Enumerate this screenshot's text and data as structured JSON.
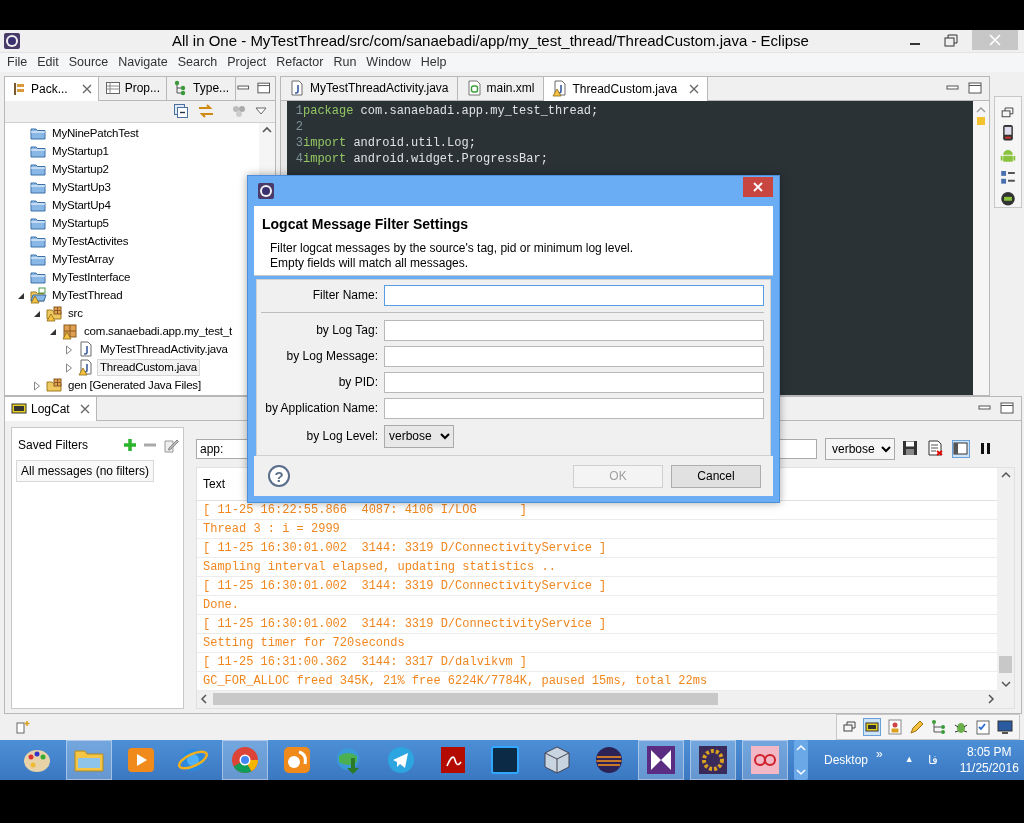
{
  "window": {
    "title": "All in One - MyTestThread/src/com/sanaebadi/app/my_test_thread/ThreadCustom.java - Eclipse"
  },
  "menu": [
    "File",
    "Edit",
    "Source",
    "Navigate",
    "Search",
    "Project",
    "Refactor",
    "Run",
    "Window",
    "Help"
  ],
  "explorer": {
    "tabs": [
      {
        "label": "Pack...",
        "selected": true
      },
      {
        "label": "Prop...",
        "selected": false
      },
      {
        "label": "Type...",
        "selected": false
      }
    ],
    "tree": [
      {
        "label": "MyNinePatchTest",
        "kind": "closed-project",
        "warning": false,
        "selected": false
      },
      {
        "label": "MyStartup1",
        "kind": "closed-project",
        "warning": false,
        "selected": false
      },
      {
        "label": "MyStartup2",
        "kind": "closed-project",
        "warning": false,
        "selected": false
      },
      {
        "label": "MyStartUp3",
        "kind": "closed-project",
        "warning": false,
        "selected": false
      },
      {
        "label": "MyStartUp4",
        "kind": "closed-project",
        "warning": false,
        "selected": false
      },
      {
        "label": "MyStartup5",
        "kind": "closed-project",
        "warning": false,
        "selected": false
      },
      {
        "label": "MyTestActivites",
        "kind": "closed-project",
        "warning": false,
        "selected": false
      },
      {
        "label": "MyTestArray",
        "kind": "closed-project",
        "warning": false,
        "selected": false
      },
      {
        "label": "MyTestInterface",
        "kind": "closed-project",
        "warning": false,
        "selected": false
      },
      {
        "label": "MyTestThread",
        "kind": "project",
        "warning": true,
        "selected": false,
        "expanded": true,
        "children": [
          {
            "label": "src",
            "kind": "source-folder",
            "warning": true,
            "selected": false,
            "expanded": true,
            "children": [
              {
                "label": "com.sanaebadi.app.my_test_t",
                "kind": "package",
                "warning": true,
                "selected": false,
                "expanded": true,
                "children": [
                  {
                    "label": "MyTestThreadActivity.java",
                    "kind": "java-file",
                    "warning": false,
                    "selected": false,
                    "expanded": false
                  },
                  {
                    "label": "ThreadCustom.java",
                    "kind": "java-file",
                    "warning": true,
                    "selected": true,
                    "expanded": false
                  }
                ]
              }
            ]
          },
          {
            "label": "gen [Generated Java Files]",
            "kind": "source-folder",
            "warning": false,
            "selected": false,
            "expanded": false
          }
        ]
      }
    ]
  },
  "editor": {
    "tabs": [
      {
        "label": "MyTestThreadActivity.java",
        "kind": "java",
        "warning": false,
        "selected": false
      },
      {
        "label": "main.xml",
        "kind": "xml",
        "warning": false,
        "selected": false
      },
      {
        "label": "ThreadCustom.java",
        "kind": "java",
        "warning": true,
        "selected": true
      }
    ],
    "lines": [
      {
        "number": "1",
        "keyword": "package",
        "rest": " com.sanaebadi.app.my_test_thread;"
      },
      {
        "number": "2"
      },
      {
        "number": "3",
        "keyword": "import",
        "rest": " android.util.Log;"
      },
      {
        "number": "4",
        "keyword": "import",
        "rest": " android.widget.ProgressBar;"
      }
    ]
  },
  "logcat": {
    "title": "LogCat",
    "saved_filters": {
      "title": "Saved Filters",
      "items": [
        {
          "label": "All messages (no filters)",
          "selected": true
        }
      ]
    },
    "search": {
      "value": "app:"
    },
    "level": "verbose",
    "toolbar": [
      {
        "kind": "save",
        "selected": false
      },
      {
        "kind": "clear",
        "selected": false
      },
      {
        "kind": "panel",
        "selected": true
      },
      {
        "kind": "pause",
        "selected": false
      }
    ],
    "columns": [
      "Text"
    ],
    "rows": [
      "[ 11-25 16:22:55.866  4087: 4106 I/LOG      ]",
      "Thread 3 : i = 2999",
      "[ 11-25 16:30:01.002  3144: 3319 D/ConnectivityService ]",
      "Sampling interval elapsed, updating statistics ..",
      "[ 11-25 16:30:01.002  3144: 3319 D/ConnectivityService ]",
      "Done.",
      "[ 11-25 16:30:01.002  3144: 3319 D/ConnectivityService ]",
      "Setting timer for 720seconds",
      "[ 11-25 16:31:00.362  3144: 3317 D/dalvikvm ]",
      "GC_FOR_ALLOC freed 345K, 21% free 6224K/7784K, paused 15ms, total 22ms"
    ]
  },
  "dialog": {
    "heading": "Logcat Message Filter Settings",
    "description": [
      "Filter logcat messages by the source's tag, pid or minimum log level.",
      "Empty fields will match all messages."
    ],
    "name_field": {
      "label": "Filter Name:",
      "focused": true
    },
    "fields": [
      {
        "label": "by Log Tag:",
        "focused": false
      },
      {
        "label": "by Log Message:",
        "focused": false
      },
      {
        "label": "by PID:",
        "focused": false
      },
      {
        "label": "by Application Name:",
        "focused": false
      }
    ],
    "level": {
      "label": "by Log Level:",
      "value": "verbose"
    },
    "help": "?",
    "buttons": [
      {
        "label": "OK",
        "disabled": true
      },
      {
        "label": "Cancel",
        "disabled": false
      }
    ]
  },
  "taskbar": {
    "apps": [
      {
        "active": false
      },
      {
        "active": true
      },
      {
        "active": false
      },
      {
        "active": false
      },
      {
        "active": true
      },
      {
        "active": false
      },
      {
        "active": false
      },
      {
        "active": false
      },
      {
        "active": false
      },
      {
        "active": false
      },
      {
        "active": false
      },
      {
        "active": false
      },
      {
        "active": true
      },
      {
        "active": true
      },
      {
        "active": true
      }
    ],
    "desktop": "Desktop",
    "chevron": "»",
    "tray_arrow": "▲",
    "language": "فا",
    "time": "8:05 PM",
    "date": "11/25/2016"
  }
}
